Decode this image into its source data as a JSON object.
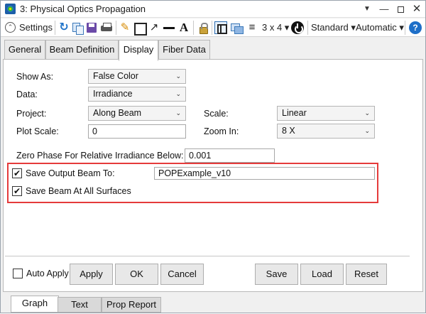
{
  "window": {
    "title": "3: Physical Optics Propagation"
  },
  "toolbar": {
    "settings_label": "Settings",
    "layout_label": "3 x 4",
    "standard_label": "Standard",
    "automatic_label": "Automatic",
    "help_label": "?"
  },
  "tabs": [
    {
      "label": "General"
    },
    {
      "label": "Beam Definition"
    },
    {
      "label": "Display"
    },
    {
      "label": "Fiber Data"
    }
  ],
  "form": {
    "show_as": {
      "label": "Show As:",
      "value": "False Color"
    },
    "data": {
      "label": "Data:",
      "value": "Irradiance"
    },
    "project": {
      "label": "Project:",
      "value": "Along Beam"
    },
    "scale": {
      "label": "Scale:",
      "value": "Linear"
    },
    "plot_scale": {
      "label": "Plot Scale:",
      "value": "0"
    },
    "zoom_in": {
      "label": "Zoom In:",
      "value": "8 X"
    },
    "zero_phase": {
      "label": "Zero Phase For Relative Irradiance Below:",
      "value": "0.001"
    },
    "save_output_beam": {
      "label": "Save Output Beam To:",
      "checked": true,
      "value": "POPExample_v10"
    },
    "save_all_surfaces": {
      "label": "Save Beam At All Surfaces",
      "checked": true
    }
  },
  "buttons": {
    "auto_apply": {
      "label": "Auto Apply",
      "checked": false
    },
    "apply": "Apply",
    "ok": "OK",
    "cancel": "Cancel",
    "save": "Save",
    "load": "Load",
    "reset": "Reset"
  },
  "bottom_tabs": [
    {
      "label": "Graph"
    },
    {
      "label": "Text"
    },
    {
      "label": "Prop Report"
    }
  ],
  "colors": {
    "highlight_border": "#e53b3b",
    "accent": "#1e6fc8"
  }
}
